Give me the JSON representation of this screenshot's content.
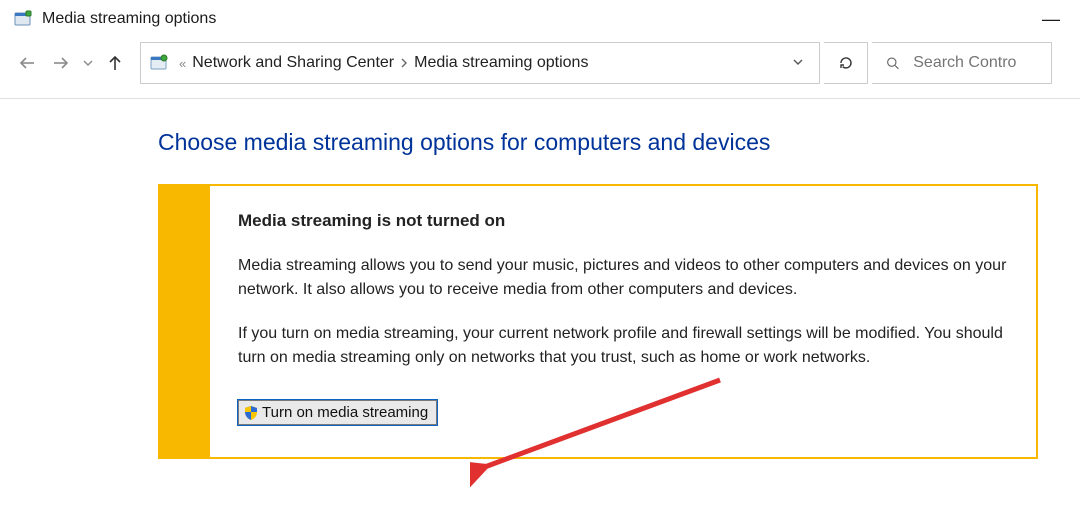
{
  "window": {
    "title": "Media streaming options",
    "minimize_glyph": "—"
  },
  "breadcrumb": {
    "ellipsis": "«",
    "item1": "Network and Sharing Center",
    "item2": "Media streaming options"
  },
  "search": {
    "placeholder": "Search Contro"
  },
  "main": {
    "heading": "Choose media streaming options for computers and devices",
    "notice_title": "Media streaming is not turned on",
    "para1": "Media streaming allows you to send your music, pictures and videos to other computers and devices on your network.  It also allows you to receive media from other computers and devices.",
    "para2": "If you turn on media streaming, your current network profile and firewall settings will be modified.  You should turn on media streaming only on networks that you trust, such as home or work networks.",
    "button_label": "Turn on media streaming"
  }
}
